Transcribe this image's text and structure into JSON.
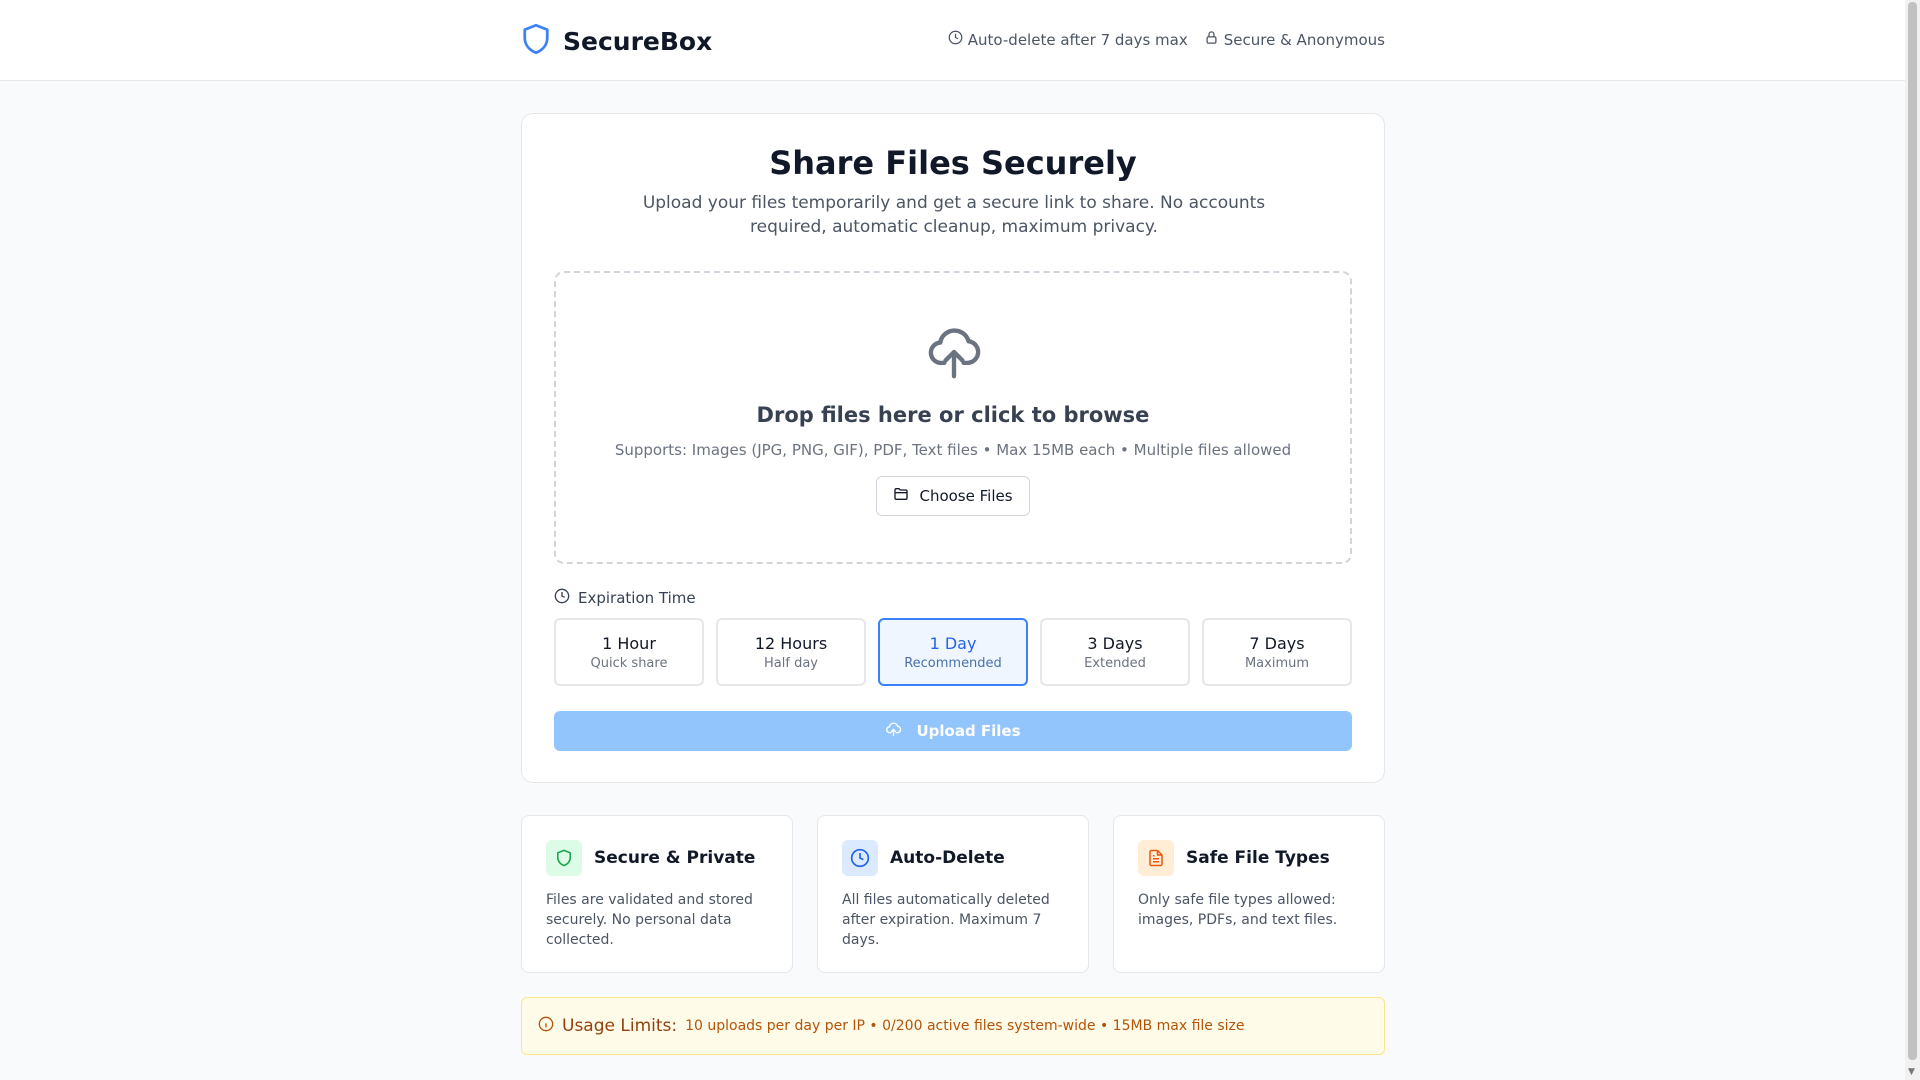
{
  "header": {
    "brand": "SecureBox",
    "meta": [
      {
        "icon": "clock-icon",
        "label": "Auto-delete after 7 days max"
      },
      {
        "icon": "lock-icon",
        "label": "Secure & Anonymous"
      }
    ]
  },
  "main": {
    "title": "Share Files Securely",
    "subtitle": "Upload your files temporarily and get a secure link to share. No accounts required, automatic cleanup, maximum privacy.",
    "dropzone": {
      "icon": "cloud-upload-icon",
      "title": "Drop files here or click to browse",
      "support": "Supports: Images (JPG, PNG, GIF), PDF, Text files • Max 15MB each • Multiple files allowed",
      "choose_label": "Choose Files"
    },
    "expiration": {
      "label": "Expiration Time",
      "selected": "1 Day",
      "options": [
        {
          "label": "1 Hour",
          "sub": "Quick share"
        },
        {
          "label": "12 Hours",
          "sub": "Half day"
        },
        {
          "label": "1 Day",
          "sub": "Recommended"
        },
        {
          "label": "3 Days",
          "sub": "Extended"
        },
        {
          "label": "7 Days",
          "sub": "Maximum"
        }
      ]
    },
    "upload_label": "Upload Files"
  },
  "features": [
    {
      "icon": "shield-icon",
      "title": "Secure & Private",
      "desc": "Files are validated and stored securely. No personal data collected.",
      "color": "#16a34a",
      "bg": "#dcfce7"
    },
    {
      "icon": "clock-icon",
      "title": "Auto-Delete",
      "desc": "All files automatically deleted after expiration. Maximum 7 days.",
      "color": "#2563eb",
      "bg": "#dbeafe"
    },
    {
      "icon": "file-text-icon",
      "title": "Safe File Types",
      "desc": "Only safe file types allowed: images, PDFs, and text files.",
      "color": "#ea580c",
      "bg": "#ffedd5"
    }
  ],
  "limits": {
    "label": "Usage Limits:",
    "text": "10 uploads per day per IP • 0/200 active files system-wide • 15MB max file size"
  },
  "colors": {
    "accent": "#2563eb",
    "upload_disabled": "#93c5fd"
  }
}
